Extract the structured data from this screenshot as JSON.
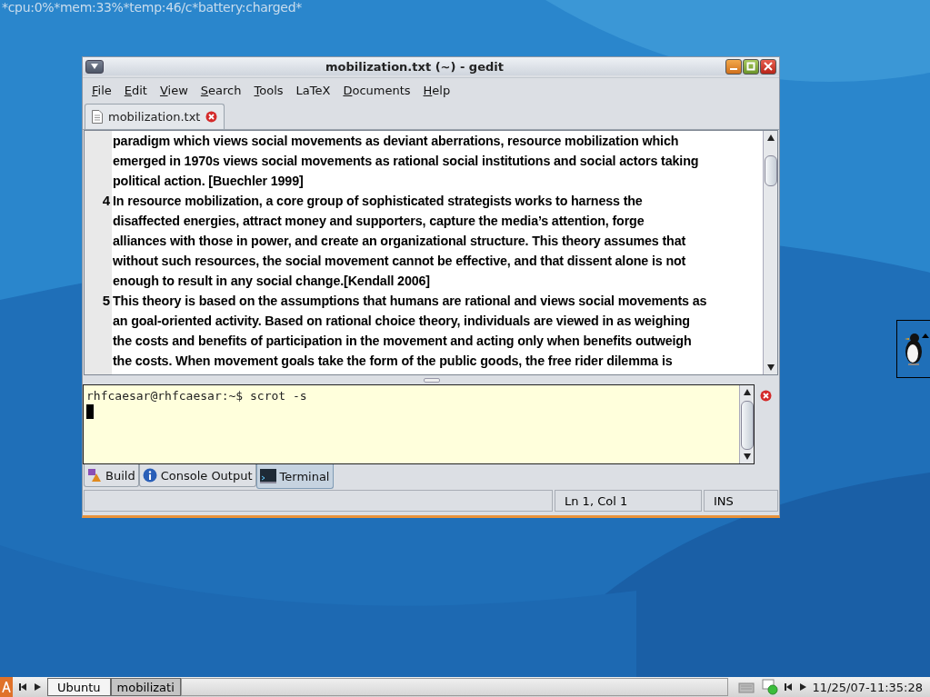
{
  "status_text": "*cpu:0%*mem:33%*temp:46/c*battery:charged*",
  "window": {
    "title": "mobilization.txt (~) - gedit"
  },
  "menu": [
    {
      "label": "File",
      "mnemonic": true
    },
    {
      "label": "Edit",
      "mnemonic": true
    },
    {
      "label": "View",
      "mnemonic": true
    },
    {
      "label": "Search",
      "mnemonic": true
    },
    {
      "label": "Tools",
      "mnemonic": true
    },
    {
      "label": "LaTeX",
      "mnemonic": false
    },
    {
      "label": "Documents",
      "mnemonic": true
    },
    {
      "label": "Help",
      "mnemonic": true
    }
  ],
  "document_tabs": [
    {
      "label": "mobilization.txt",
      "selected": true
    }
  ],
  "editor": {
    "paragraphs": [
      {
        "lines": [
          "paradigm which views social movements as deviant aberrations, resource mobilization which",
          "emerged in 1970s views social movements as rational social institutions and social actors taking",
          "political action. [Buechler 1999]"
        ]
      },
      {
        "number": "4",
        "lines": [
          "In resource mobilization, a core group of sophisticated strategists works to harness the",
          "disaffected energies, attract money and supporters, capture the media’s attention, forge",
          "alliances with those in power, and create an organizational structure. This theory assumes that",
          "without such resources, the social movement cannot be effective, and that dissent alone is not",
          "enough to result in any social change.[Kendall 2006]"
        ]
      },
      {
        "number": "5",
        "lines": [
          "This theory is based on the assumptions that humans are rational and views social movements as",
          "an goal-oriented activity. Based on rational choice theory, individuals are viewed in as weighing",
          "the costs and benefits of participation in the movement and acting only when benefits outweigh",
          "the costs. When movement goals take the form of the public goods, the free rider dilemma is"
        ]
      }
    ]
  },
  "terminal": {
    "lines": [
      "rhfcaesar@rhfcaesar:~$ scrot -s"
    ]
  },
  "bottom_tabs": [
    {
      "label": "Build",
      "selected": false,
      "kind": "build"
    },
    {
      "label": "Console Output",
      "selected": false,
      "kind": "info"
    },
    {
      "label": "Terminal",
      "selected": true,
      "kind": "terminal"
    }
  ],
  "status_bar": {
    "position": "Ln 1, Col 1",
    "mode": "INS"
  },
  "taskbar": {
    "tasks": [
      {
        "label": "Ubuntu",
        "selected": false
      },
      {
        "label": "mobilizati",
        "selected": true
      }
    ],
    "clock": "11/25/07-11:35:28"
  }
}
